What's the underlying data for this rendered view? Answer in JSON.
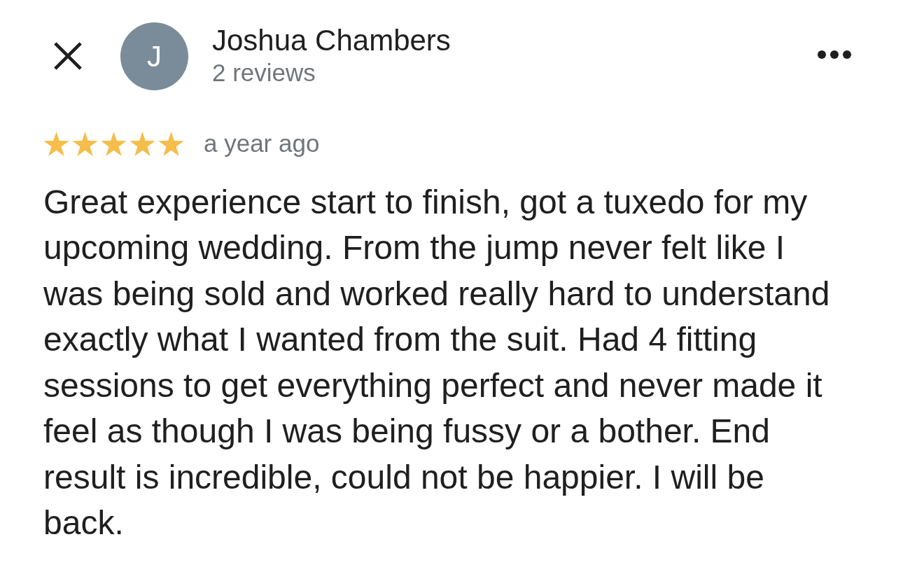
{
  "reviewer": {
    "initial": "J",
    "name": "Joshua Chambers",
    "review_count": "2 reviews"
  },
  "review": {
    "stars": 5,
    "time": "a year ago",
    "text": "Great experience start to finish, got a tuxedo for my upcoming wedding. From the jump never felt like I was being sold and worked really hard to understand exactly what I wanted from the suit. Had 4 fitting sessions to get everything perfect and never made it feel as though I was being fussy or a bother. End result is incredible, could not be happier. I will be back."
  }
}
